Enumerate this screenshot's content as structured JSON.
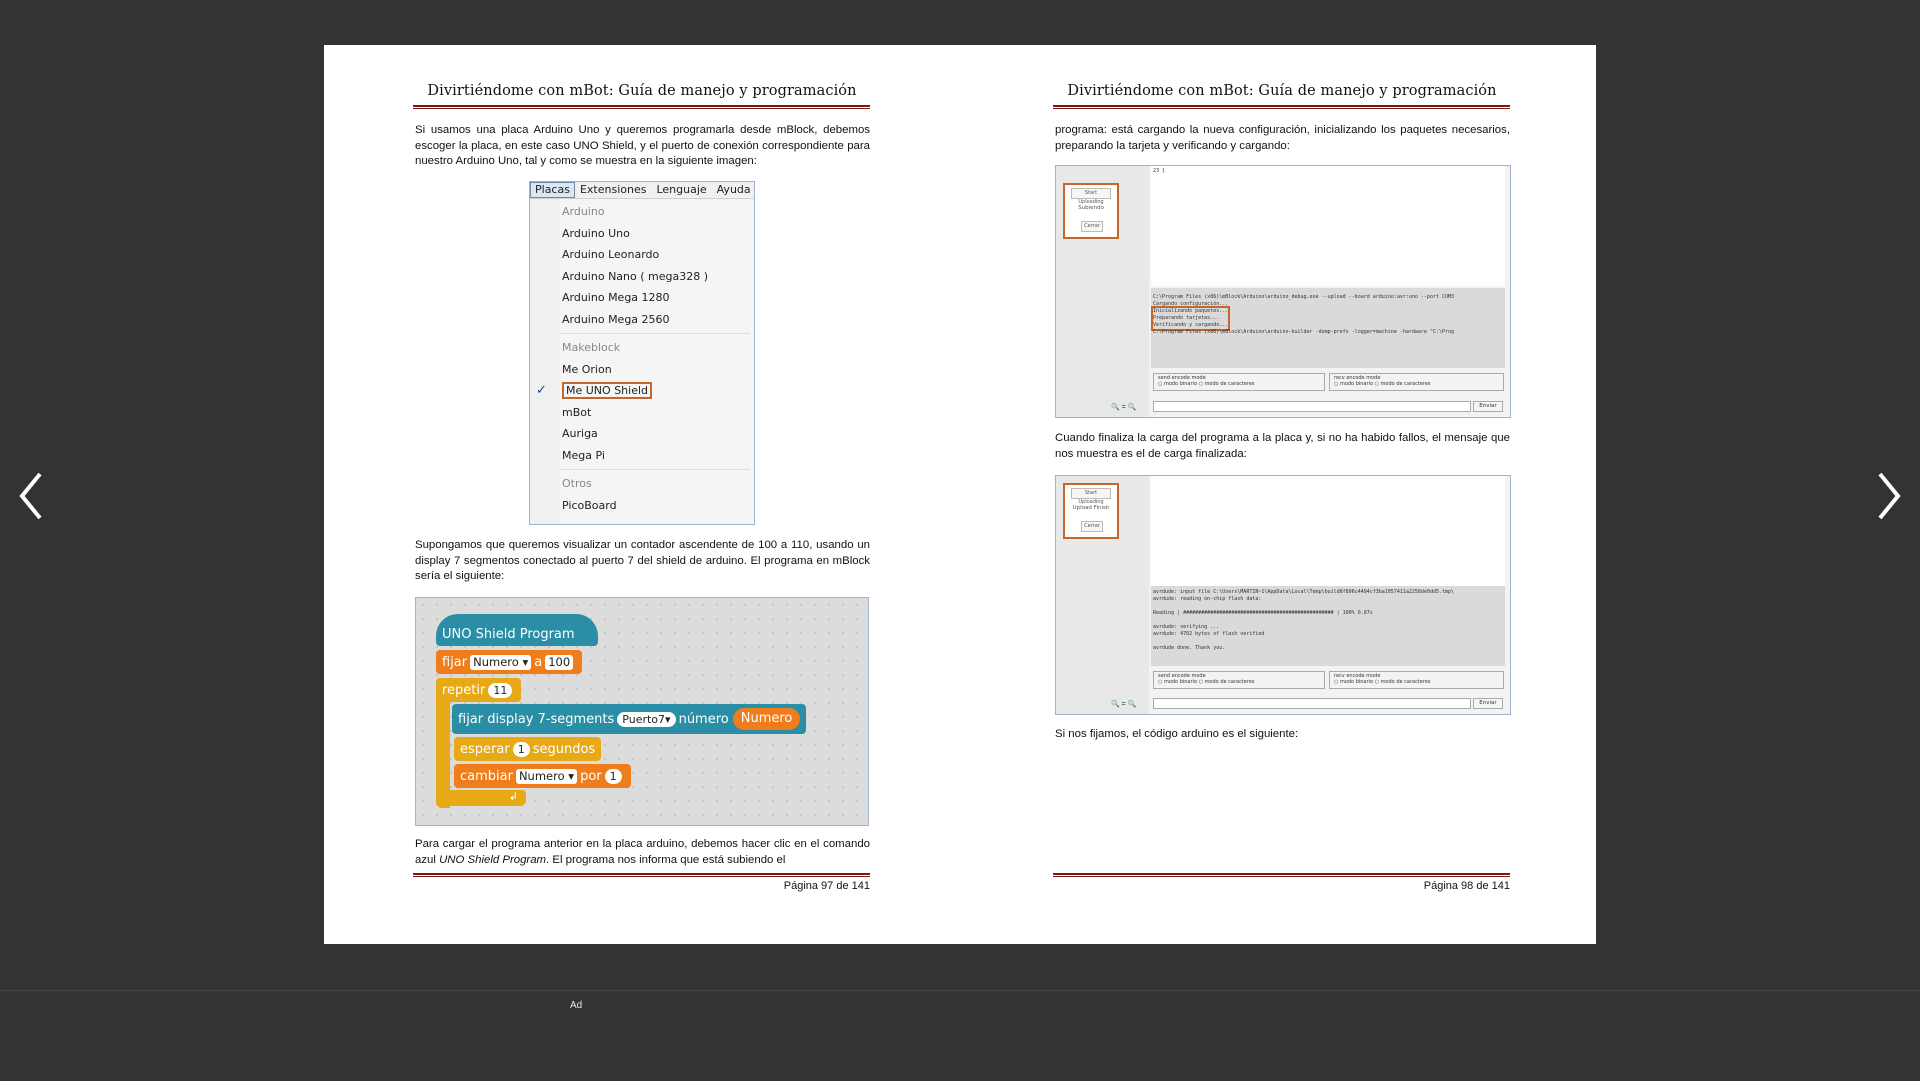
{
  "viewer": {
    "prev_icon": "chevron-left-icon",
    "next_icon": "chevron-right-icon",
    "ad_label": "Ad"
  },
  "left_page": {
    "running_head": "Divirtiéndome con mBot: Guía de manejo y programación",
    "para1": "Si usamos una placa Arduino Uno y queremos programarla desde mBlock, debemos escoger la placa, en este caso UNO Shield, y el puerto de conexión correspondiente para nuestro Arduino Uno, tal y como se muestra en la siguiente imagen:",
    "menu": {
      "bar": [
        "Placas",
        "Extensiones",
        "Lenguaje",
        "Ayuda"
      ],
      "groups": [
        {
          "title": "Arduino",
          "items": [
            "Arduino Uno",
            "Arduino Leonardo",
            "Arduino Nano ( mega328 )",
            "Arduino Mega 1280",
            "Arduino Mega 2560"
          ]
        },
        {
          "title": "Makeblock",
          "items": [
            "Me Orion",
            "Me UNO Shield",
            "mBot",
            "Auriga",
            "Mega Pi"
          ]
        },
        {
          "title": "Otros",
          "items": [
            "PicoBoard"
          ]
        }
      ],
      "selected": "Me UNO Shield"
    },
    "para2": "Supongamos que queremos visualizar un contador ascendente de 100 a 110, usando un display 7 segmentos conectado al puerto 7 del shield de arduino. El programa en mBlock sería el siguiente:",
    "blocks": {
      "hat": "UNO Shield Program",
      "set_kw": "fijar",
      "set_var": "Numero",
      "set_a": "a",
      "set_val": "100",
      "repeat_kw": "repetir",
      "repeat_val": "11",
      "display_kw": "fijar display 7-segments",
      "display_port": "Puerto7",
      "display_num_kw": "número",
      "display_var": "Numero",
      "wait_kw": "esperar",
      "wait_val": "1",
      "wait_unit": "segundos",
      "change_kw": "cambiar",
      "change_var": "Numero",
      "change_by": "por",
      "change_val": "1"
    },
    "para3_a": "Para cargar el programa anterior en la placa arduino, debemos hacer clic en el comando azul ",
    "para3_em": "UNO Shield Program",
    "para3_b": ". El programa nos informa que está subiendo el",
    "page_num": "Página 97 de 141"
  },
  "right_page": {
    "running_head": "Divirtiéndome con mBot: Guía de manejo y programación",
    "para1": "programa: está cargando la nueva configuración, inicializando los paquetes necesarios, preparando la tarjeta y verificando y cargando:",
    "shot1": {
      "btn_top": "Start Uploading",
      "status": "Subiendo",
      "btn_bottom": "Cerrar",
      "out_top": "23 }",
      "console": [
        "C:\\Program Files (x86)\\mBlock\\Arduino\\arduino_debug.exe --upload --board arduino:avr:uno --port COM3",
        "Cargando configuración...",
        "Inicializando paquetes...",
        "Preparando tarjetas...",
        "Verificando y cargando...",
        "C:\\Program Files (x86)\\mBlock\\Arduino\\arduino-builder -dump-prefs -logger=machine -hardware \"C:\\Prog"
      ],
      "send_mode": "send encode mode",
      "recv_mode": "recv encode mode",
      "binary": "modo binario",
      "chars": "modo de caracteres",
      "send_btn": "Enviar"
    },
    "para2": "Cuando finaliza la carga del programa a la placa y, si no ha habido fallos, el mensaje que nos muestra es el de carga finalizada:",
    "shot2": {
      "btn_top": "Start Uploading",
      "status": "Upload Finish",
      "btn_bottom": "Cerrar",
      "console": [
        "avrdude: input file C:\\Users\\MARTIN~1\\AppData\\Local\\Temp\\build6f806c4494cf3ba1057411a2258de0dd5.tmp\\",
        "avrdude: reading on-chip flash data:",
        "",
        "Reading | ################################################## | 100% 0.87s",
        "",
        "avrdude: verifying ...",
        "avrdude: 4702 bytes of flash verified",
        "",
        "avrdude done.  Thank you."
      ],
      "send_mode": "send encode mode",
      "recv_mode": "recv encode mode",
      "binary": "modo binario",
      "chars": "modo de caracteres",
      "send_btn": "Enviar"
    },
    "para3": "Si nos fijamos, el código arduino es el siguiente:",
    "page_num": "Página 98 de 141"
  },
  "colors": {
    "viewer_bg": "#333333",
    "rule": "#7a1a1a",
    "highlight": "#c7652a",
    "block_blue": "#2a8fa6",
    "block_orange": "#f07d1c",
    "block_gold": "#e8a917"
  }
}
